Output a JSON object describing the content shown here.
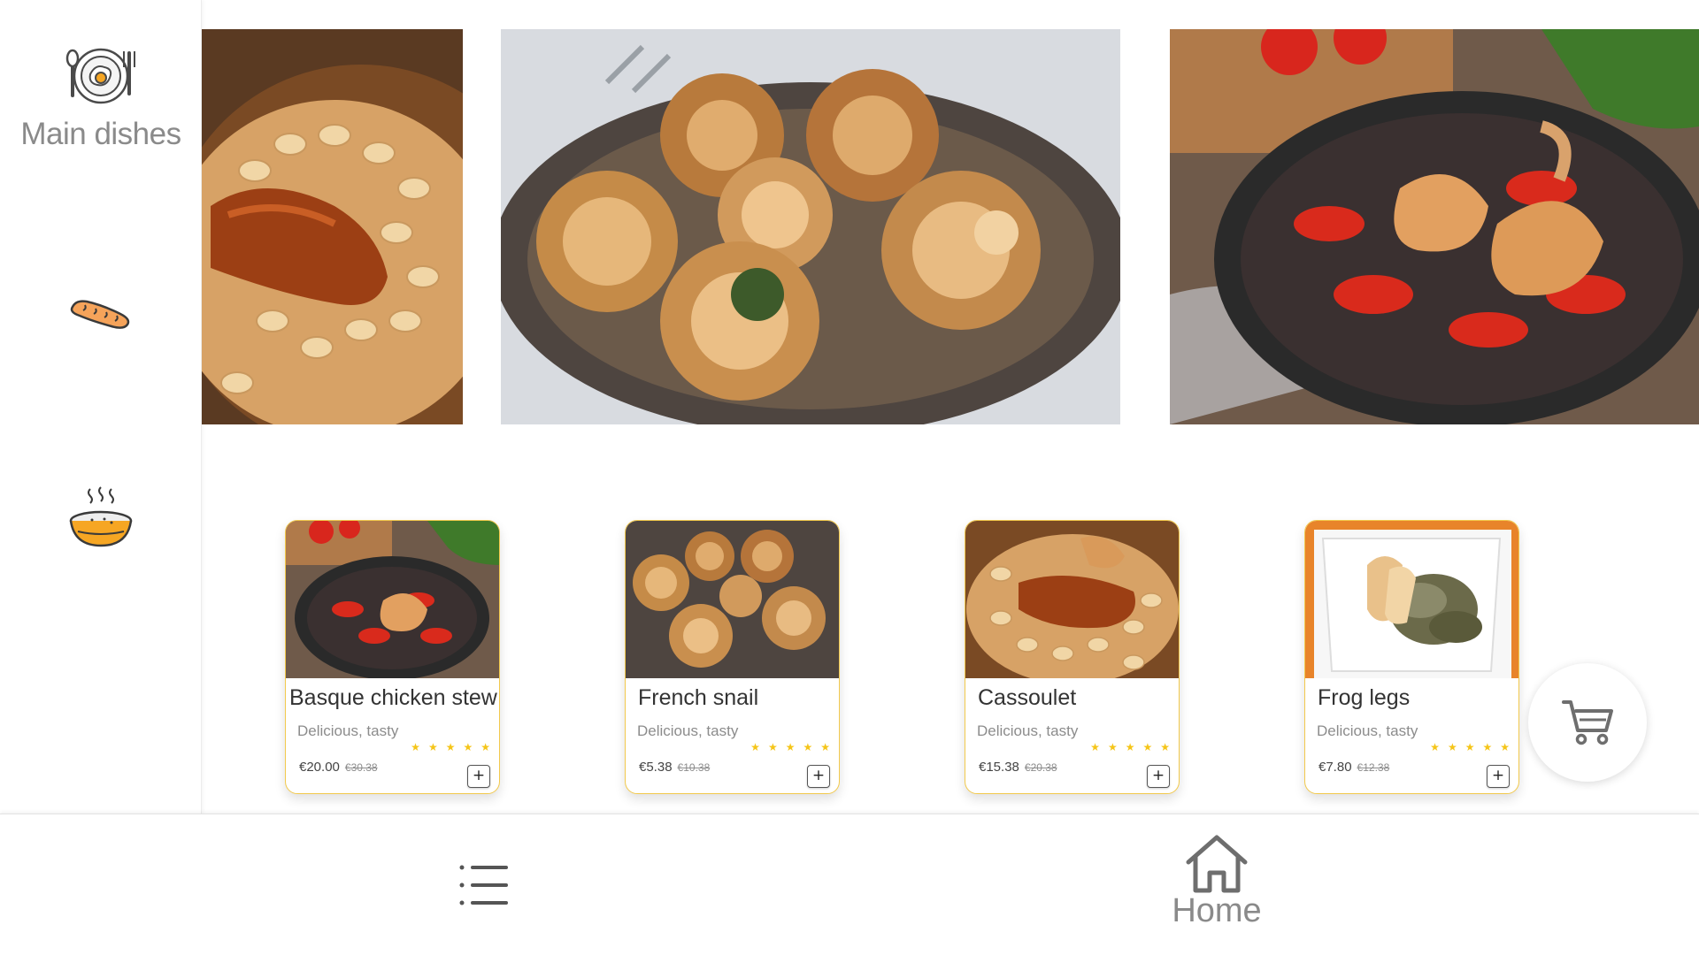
{
  "sidebar": {
    "items": [
      {
        "label": "Main dishes",
        "icon": "plate-egg-icon"
      },
      {
        "label": "",
        "icon": "bread-icon"
      },
      {
        "label": "",
        "icon": "soup-bowl-icon"
      }
    ]
  },
  "banner": {
    "images": [
      "cassoulet-photo",
      "escargot-photo",
      "basque-chicken-photo"
    ]
  },
  "products": [
    {
      "name": "Basque chicken stew",
      "desc": "Delicious, tasty",
      "price": "€20.00",
      "old_price": "€30.38",
      "rating": 5,
      "add": "+"
    },
    {
      "name": "French snail",
      "desc": "Delicious, tasty",
      "price": "€5.38",
      "old_price": "€10.38",
      "rating": 5,
      "add": "+"
    },
    {
      "name": "Cassoulet",
      "desc": "Delicious, tasty",
      "price": "€15.38",
      "old_price": "€20.38",
      "rating": 5,
      "add": "+"
    },
    {
      "name": "Frog legs",
      "desc": "Delicious, tasty",
      "price": "€7.80",
      "old_price": "€12.38",
      "rating": 5,
      "add": "+"
    }
  ],
  "cart": {
    "icon": "cart-icon"
  },
  "bottom_nav": {
    "list_icon": "list-icon",
    "home_label": "Home",
    "home_icon": "home-icon"
  },
  "colors": {
    "accent": "#f2c94c",
    "star": "#f5c518",
    "label_gray": "#8a8a8a"
  }
}
